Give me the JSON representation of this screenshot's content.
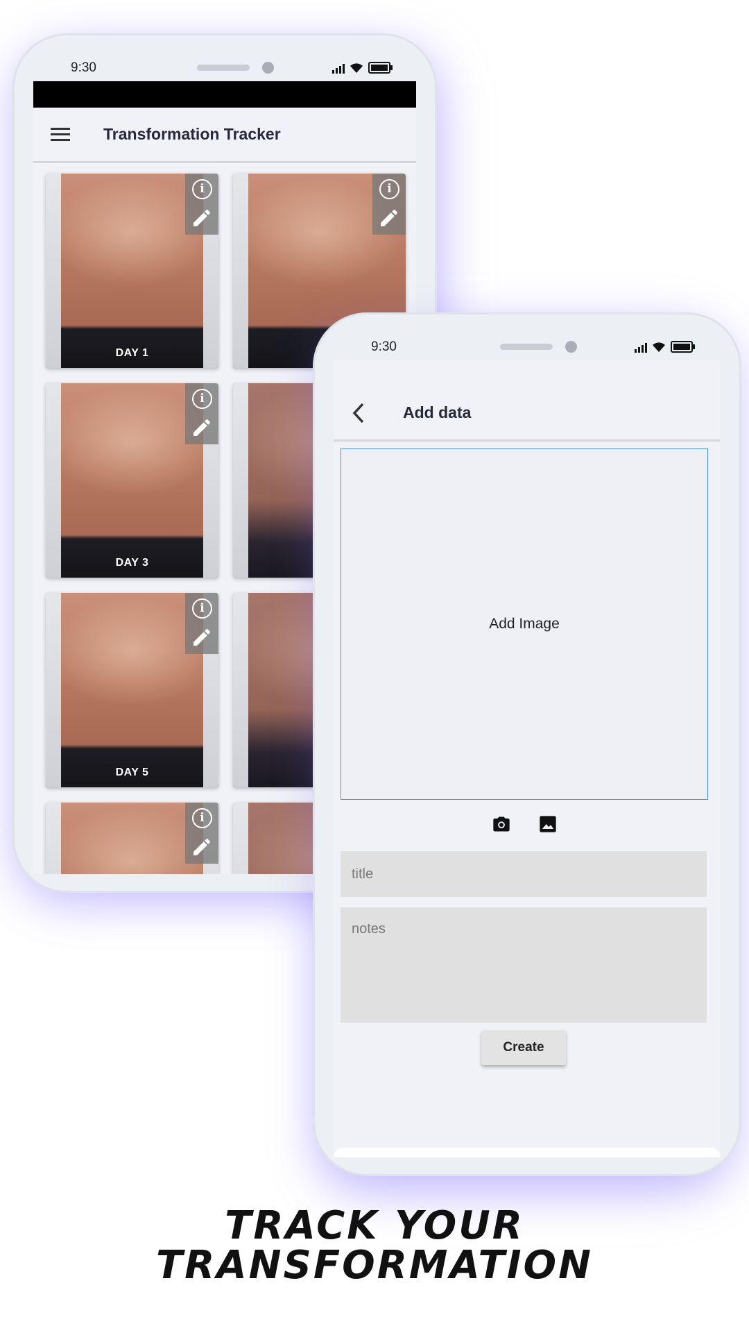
{
  "phone_back": {
    "status": {
      "time": "9:30"
    },
    "appbar": {
      "title": "Transformation Tracker"
    },
    "tiles": [
      {
        "label": "DAY 1"
      },
      {
        "label": "D"
      },
      {
        "label": "DAY 3"
      },
      {
        "label": "D"
      },
      {
        "label": "DAY 5"
      },
      {
        "label": "D"
      },
      {
        "label": ""
      },
      {
        "label": ""
      }
    ]
  },
  "phone_front": {
    "status": {
      "time": "9:30"
    },
    "appbar": {
      "title": "Add data",
      "back_icon": "chevron-left-icon"
    },
    "image_area": {
      "label": "Add Image"
    },
    "icons": [
      "camera-icon",
      "gallery-icon"
    ],
    "title_field": {
      "placeholder": "title",
      "value": ""
    },
    "notes_field": {
      "placeholder": "notes",
      "value": ""
    },
    "create_label": "Create"
  },
  "headline": {
    "line1": "TRACK YOUR",
    "line2": "TRANSFORMATION"
  },
  "colors": {
    "accent_border": "#4a90d9",
    "screen_bg": "#f1f2f7",
    "field_bg": "#e0e0e0"
  }
}
